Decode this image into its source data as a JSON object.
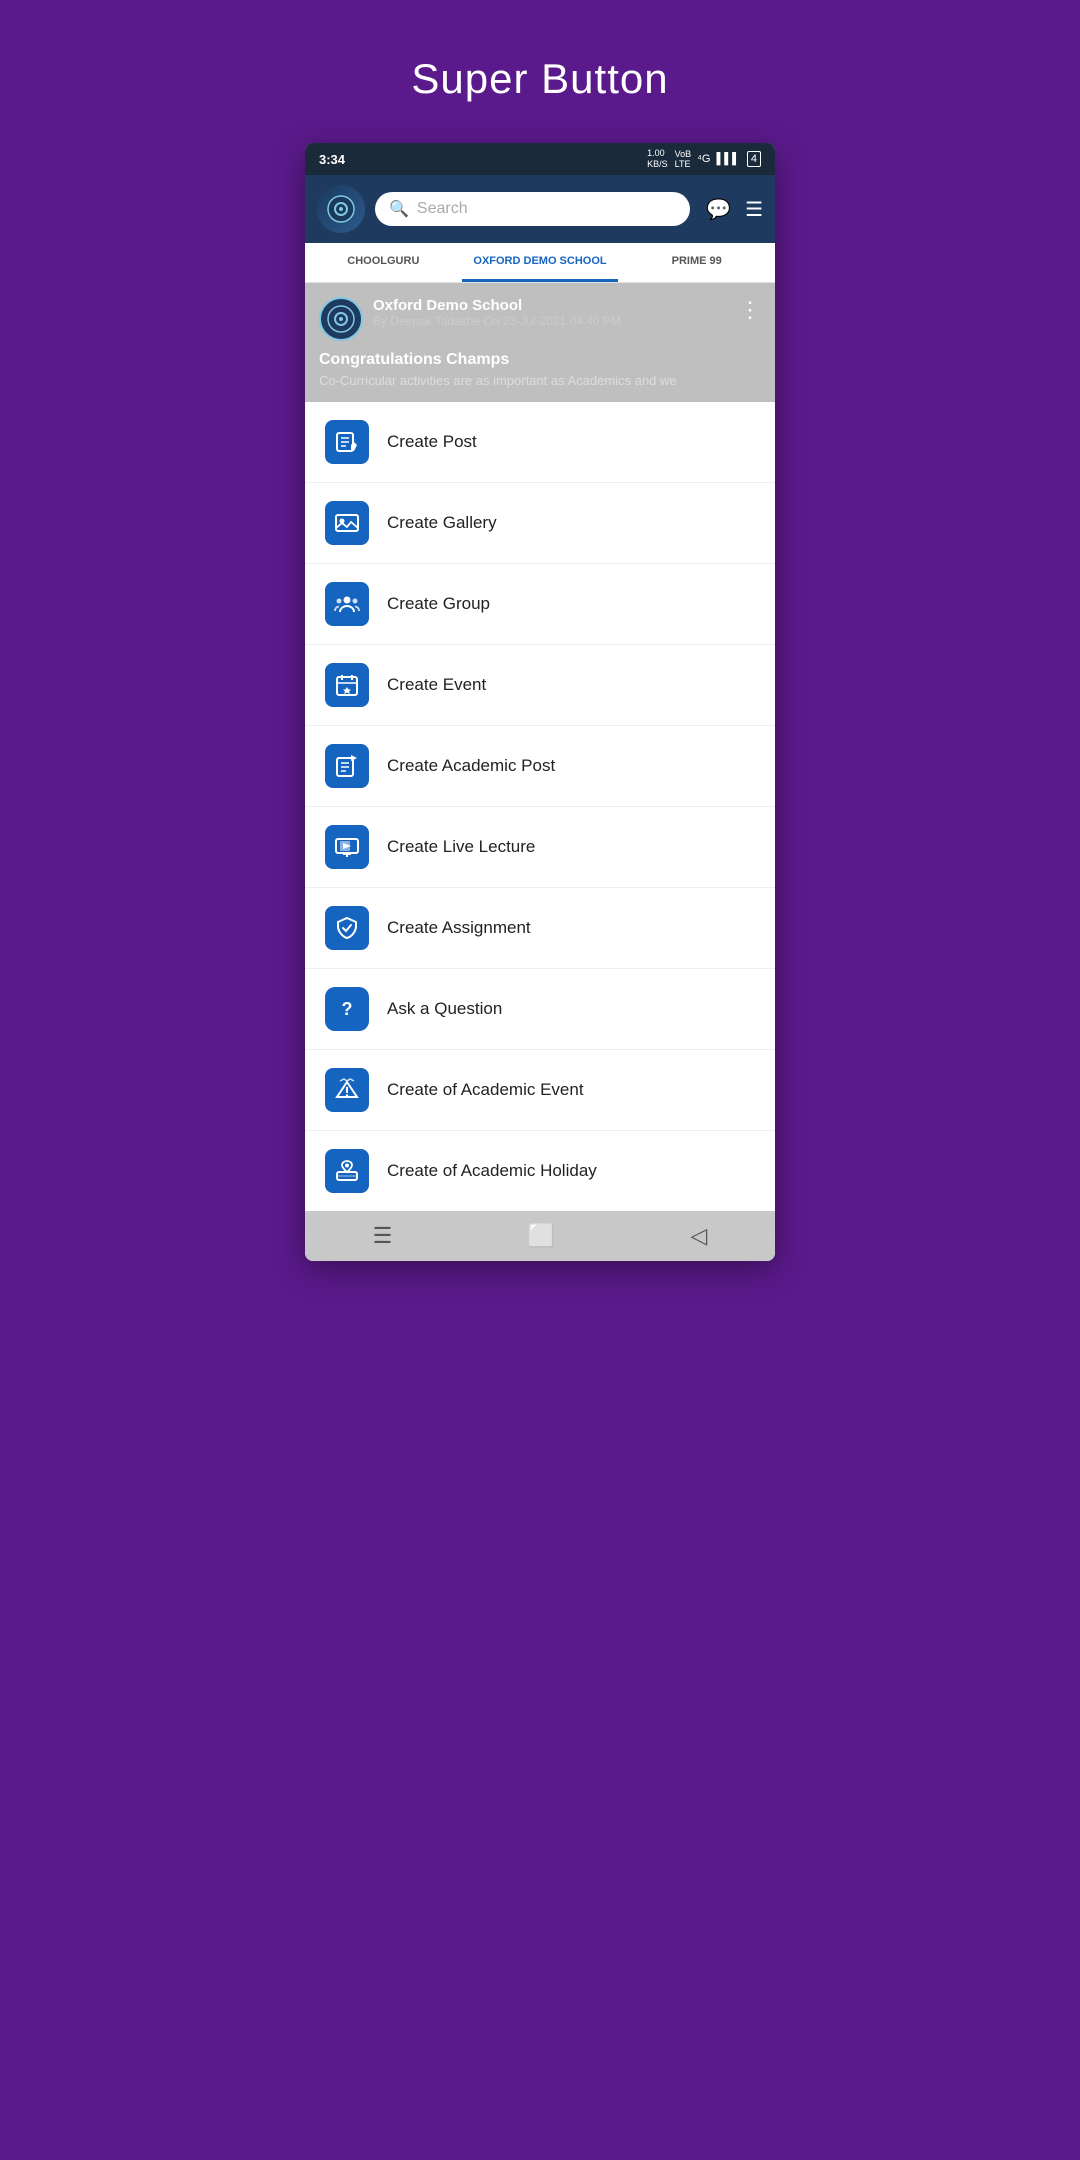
{
  "page": {
    "title": "Super Button"
  },
  "statusBar": {
    "time": "3:34",
    "network": "4G",
    "speed": "1.00 KB/S"
  },
  "header": {
    "searchPlaceholder": "Search",
    "avatarIcon": "📷"
  },
  "tabs": [
    {
      "label": "CHOOLGURU",
      "active": false
    },
    {
      "label": "OXFORD DEMO SCHOOL",
      "active": true
    },
    {
      "label": "PRIME 99",
      "active": false
    }
  ],
  "post": {
    "school": "Oxford Demo School",
    "meta": "By Deepak Tadakhe On 23-Jul-2021 04:40 PM",
    "title": "Congratulations Champs",
    "desc": "Co-Curricular activities are as important as Academics and we"
  },
  "menuItems": [
    {
      "id": "create-post",
      "label": "Create Post",
      "icon": "post"
    },
    {
      "id": "create-gallery",
      "label": "Create Gallery",
      "icon": "gallery"
    },
    {
      "id": "create-group",
      "label": "Create Group",
      "icon": "group"
    },
    {
      "id": "create-event",
      "label": "Create Event",
      "icon": "event"
    },
    {
      "id": "create-academic-post",
      "label": "Create Academic Post",
      "icon": "academic-post"
    },
    {
      "id": "create-live-lecture",
      "label": "Create Live Lecture",
      "icon": "live-lecture"
    },
    {
      "id": "create-assignment",
      "label": "Create Assignment",
      "icon": "assignment"
    },
    {
      "id": "ask-question",
      "label": "Ask a Question",
      "icon": "question"
    },
    {
      "id": "create-academic-event",
      "label": "Create of Academic Event",
      "icon": "academic-event"
    },
    {
      "id": "create-academic-holiday",
      "label": "Create of Academic Holiday",
      "icon": "academic-holiday"
    }
  ],
  "bottomNav": {
    "icons": [
      "menu",
      "square",
      "back"
    ]
  }
}
